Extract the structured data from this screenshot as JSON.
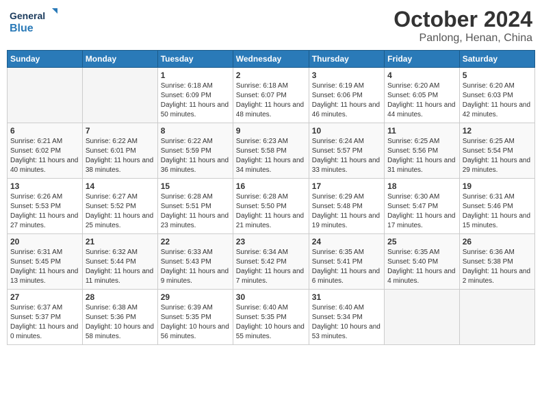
{
  "header": {
    "logo_general": "General",
    "logo_blue": "Blue",
    "title": "October 2024",
    "subtitle": "Panlong, Henan, China"
  },
  "weekdays": [
    "Sunday",
    "Monday",
    "Tuesday",
    "Wednesday",
    "Thursday",
    "Friday",
    "Saturday"
  ],
  "weeks": [
    [
      {
        "day": "",
        "sunrise": "",
        "sunset": "",
        "daylight": ""
      },
      {
        "day": "",
        "sunrise": "",
        "sunset": "",
        "daylight": ""
      },
      {
        "day": "1",
        "sunrise": "Sunrise: 6:18 AM",
        "sunset": "Sunset: 6:09 PM",
        "daylight": "Daylight: 11 hours and 50 minutes."
      },
      {
        "day": "2",
        "sunrise": "Sunrise: 6:18 AM",
        "sunset": "Sunset: 6:07 PM",
        "daylight": "Daylight: 11 hours and 48 minutes."
      },
      {
        "day": "3",
        "sunrise": "Sunrise: 6:19 AM",
        "sunset": "Sunset: 6:06 PM",
        "daylight": "Daylight: 11 hours and 46 minutes."
      },
      {
        "day": "4",
        "sunrise": "Sunrise: 6:20 AM",
        "sunset": "Sunset: 6:05 PM",
        "daylight": "Daylight: 11 hours and 44 minutes."
      },
      {
        "day": "5",
        "sunrise": "Sunrise: 6:20 AM",
        "sunset": "Sunset: 6:03 PM",
        "daylight": "Daylight: 11 hours and 42 minutes."
      }
    ],
    [
      {
        "day": "6",
        "sunrise": "Sunrise: 6:21 AM",
        "sunset": "Sunset: 6:02 PM",
        "daylight": "Daylight: 11 hours and 40 minutes."
      },
      {
        "day": "7",
        "sunrise": "Sunrise: 6:22 AM",
        "sunset": "Sunset: 6:01 PM",
        "daylight": "Daylight: 11 hours and 38 minutes."
      },
      {
        "day": "8",
        "sunrise": "Sunrise: 6:22 AM",
        "sunset": "Sunset: 5:59 PM",
        "daylight": "Daylight: 11 hours and 36 minutes."
      },
      {
        "day": "9",
        "sunrise": "Sunrise: 6:23 AM",
        "sunset": "Sunset: 5:58 PM",
        "daylight": "Daylight: 11 hours and 34 minutes."
      },
      {
        "day": "10",
        "sunrise": "Sunrise: 6:24 AM",
        "sunset": "Sunset: 5:57 PM",
        "daylight": "Daylight: 11 hours and 33 minutes."
      },
      {
        "day": "11",
        "sunrise": "Sunrise: 6:25 AM",
        "sunset": "Sunset: 5:56 PM",
        "daylight": "Daylight: 11 hours and 31 minutes."
      },
      {
        "day": "12",
        "sunrise": "Sunrise: 6:25 AM",
        "sunset": "Sunset: 5:54 PM",
        "daylight": "Daylight: 11 hours and 29 minutes."
      }
    ],
    [
      {
        "day": "13",
        "sunrise": "Sunrise: 6:26 AM",
        "sunset": "Sunset: 5:53 PM",
        "daylight": "Daylight: 11 hours and 27 minutes."
      },
      {
        "day": "14",
        "sunrise": "Sunrise: 6:27 AM",
        "sunset": "Sunset: 5:52 PM",
        "daylight": "Daylight: 11 hours and 25 minutes."
      },
      {
        "day": "15",
        "sunrise": "Sunrise: 6:28 AM",
        "sunset": "Sunset: 5:51 PM",
        "daylight": "Daylight: 11 hours and 23 minutes."
      },
      {
        "day": "16",
        "sunrise": "Sunrise: 6:28 AM",
        "sunset": "Sunset: 5:50 PM",
        "daylight": "Daylight: 11 hours and 21 minutes."
      },
      {
        "day": "17",
        "sunrise": "Sunrise: 6:29 AM",
        "sunset": "Sunset: 5:48 PM",
        "daylight": "Daylight: 11 hours and 19 minutes."
      },
      {
        "day": "18",
        "sunrise": "Sunrise: 6:30 AM",
        "sunset": "Sunset: 5:47 PM",
        "daylight": "Daylight: 11 hours and 17 minutes."
      },
      {
        "day": "19",
        "sunrise": "Sunrise: 6:31 AM",
        "sunset": "Sunset: 5:46 PM",
        "daylight": "Daylight: 11 hours and 15 minutes."
      }
    ],
    [
      {
        "day": "20",
        "sunrise": "Sunrise: 6:31 AM",
        "sunset": "Sunset: 5:45 PM",
        "daylight": "Daylight: 11 hours and 13 minutes."
      },
      {
        "day": "21",
        "sunrise": "Sunrise: 6:32 AM",
        "sunset": "Sunset: 5:44 PM",
        "daylight": "Daylight: 11 hours and 11 minutes."
      },
      {
        "day": "22",
        "sunrise": "Sunrise: 6:33 AM",
        "sunset": "Sunset: 5:43 PM",
        "daylight": "Daylight: 11 hours and 9 minutes."
      },
      {
        "day": "23",
        "sunrise": "Sunrise: 6:34 AM",
        "sunset": "Sunset: 5:42 PM",
        "daylight": "Daylight: 11 hours and 7 minutes."
      },
      {
        "day": "24",
        "sunrise": "Sunrise: 6:35 AM",
        "sunset": "Sunset: 5:41 PM",
        "daylight": "Daylight: 11 hours and 6 minutes."
      },
      {
        "day": "25",
        "sunrise": "Sunrise: 6:35 AM",
        "sunset": "Sunset: 5:40 PM",
        "daylight": "Daylight: 11 hours and 4 minutes."
      },
      {
        "day": "26",
        "sunrise": "Sunrise: 6:36 AM",
        "sunset": "Sunset: 5:38 PM",
        "daylight": "Daylight: 11 hours and 2 minutes."
      }
    ],
    [
      {
        "day": "27",
        "sunrise": "Sunrise: 6:37 AM",
        "sunset": "Sunset: 5:37 PM",
        "daylight": "Daylight: 11 hours and 0 minutes."
      },
      {
        "day": "28",
        "sunrise": "Sunrise: 6:38 AM",
        "sunset": "Sunset: 5:36 PM",
        "daylight": "Daylight: 10 hours and 58 minutes."
      },
      {
        "day": "29",
        "sunrise": "Sunrise: 6:39 AM",
        "sunset": "Sunset: 5:35 PM",
        "daylight": "Daylight: 10 hours and 56 minutes."
      },
      {
        "day": "30",
        "sunrise": "Sunrise: 6:40 AM",
        "sunset": "Sunset: 5:35 PM",
        "daylight": "Daylight: 10 hours and 55 minutes."
      },
      {
        "day": "31",
        "sunrise": "Sunrise: 6:40 AM",
        "sunset": "Sunset: 5:34 PM",
        "daylight": "Daylight: 10 hours and 53 minutes."
      },
      {
        "day": "",
        "sunrise": "",
        "sunset": "",
        "daylight": ""
      },
      {
        "day": "",
        "sunrise": "",
        "sunset": "",
        "daylight": ""
      }
    ]
  ]
}
